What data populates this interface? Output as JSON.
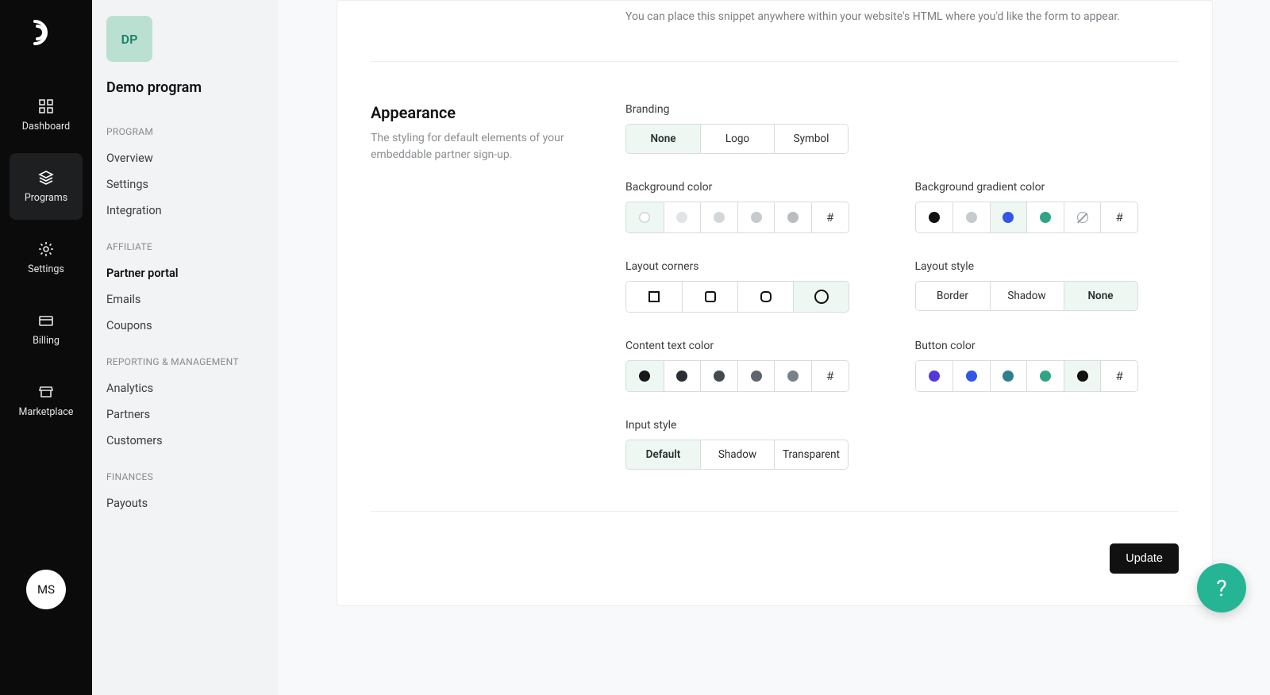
{
  "rail": {
    "dashboard": "Dashboard",
    "programs": "Programs",
    "settings": "Settings",
    "billing": "Billing",
    "marketplace": "Marketplace",
    "avatar_initials": "MS"
  },
  "sidebar": {
    "badge_initials": "DP",
    "program_name": "Demo program",
    "sections": {
      "program": {
        "header": "Program",
        "overview": "Overview",
        "settings": "Settings",
        "integration": "Integration"
      },
      "affiliate": {
        "header": "Affiliate",
        "partner_portal": "Partner portal",
        "emails": "Emails",
        "coupons": "Coupons"
      },
      "reporting": {
        "header": "Reporting & Management",
        "analytics": "Analytics",
        "partners": "Partners",
        "customers": "Customers"
      },
      "finances": {
        "header": "Finances",
        "payouts": "Payouts"
      }
    }
  },
  "main": {
    "snippet_desc": "You can place this snippet anywhere within your website's HTML where you'd like the form to appear.",
    "appearance": {
      "title": "Appearance",
      "desc": "The styling for default elements of your embeddable partner sign-up.",
      "branding": {
        "label": "Branding",
        "options": {
          "none": "None",
          "logo": "Logo",
          "symbol": "Symbol"
        },
        "selected": "None"
      },
      "bg_color": {
        "label": "Background color",
        "swatches": [
          "#ffffff",
          "#e1e4e7",
          "#d4d7da",
          "#c7cacd",
          "#babdc0"
        ],
        "hash": "#",
        "selected": 0
      },
      "bg_gradient": {
        "label": "Background gradient color",
        "swatches": [
          "#111111",
          "#c7cacd",
          "#3355e8",
          "#2fa586"
        ],
        "hash": "#",
        "selected": 2
      },
      "layout_corners": {
        "label": "Layout corners",
        "selected": 3
      },
      "layout_style": {
        "label": "Layout style",
        "options": {
          "border": "Border",
          "shadow": "Shadow",
          "none": "None"
        },
        "selected": "None"
      },
      "content_text_color": {
        "label": "Content text color",
        "swatches": [
          "#16181a",
          "#2b2f33",
          "#444a50",
          "#5e656c",
          "#7a8289"
        ],
        "hash": "#",
        "selected": 0
      },
      "button_color": {
        "label": "Button color",
        "swatches": [
          "#5638d8",
          "#3355e8",
          "#2f7f90",
          "#2fa586",
          "#111111"
        ],
        "hash": "#",
        "selected": 4
      },
      "input_style": {
        "label": "Input style",
        "options": {
          "default": "Default",
          "shadow": "Shadow",
          "transparent": "Transparent"
        },
        "selected": "Default"
      }
    },
    "update_button": "Update"
  },
  "help_fab": "?"
}
